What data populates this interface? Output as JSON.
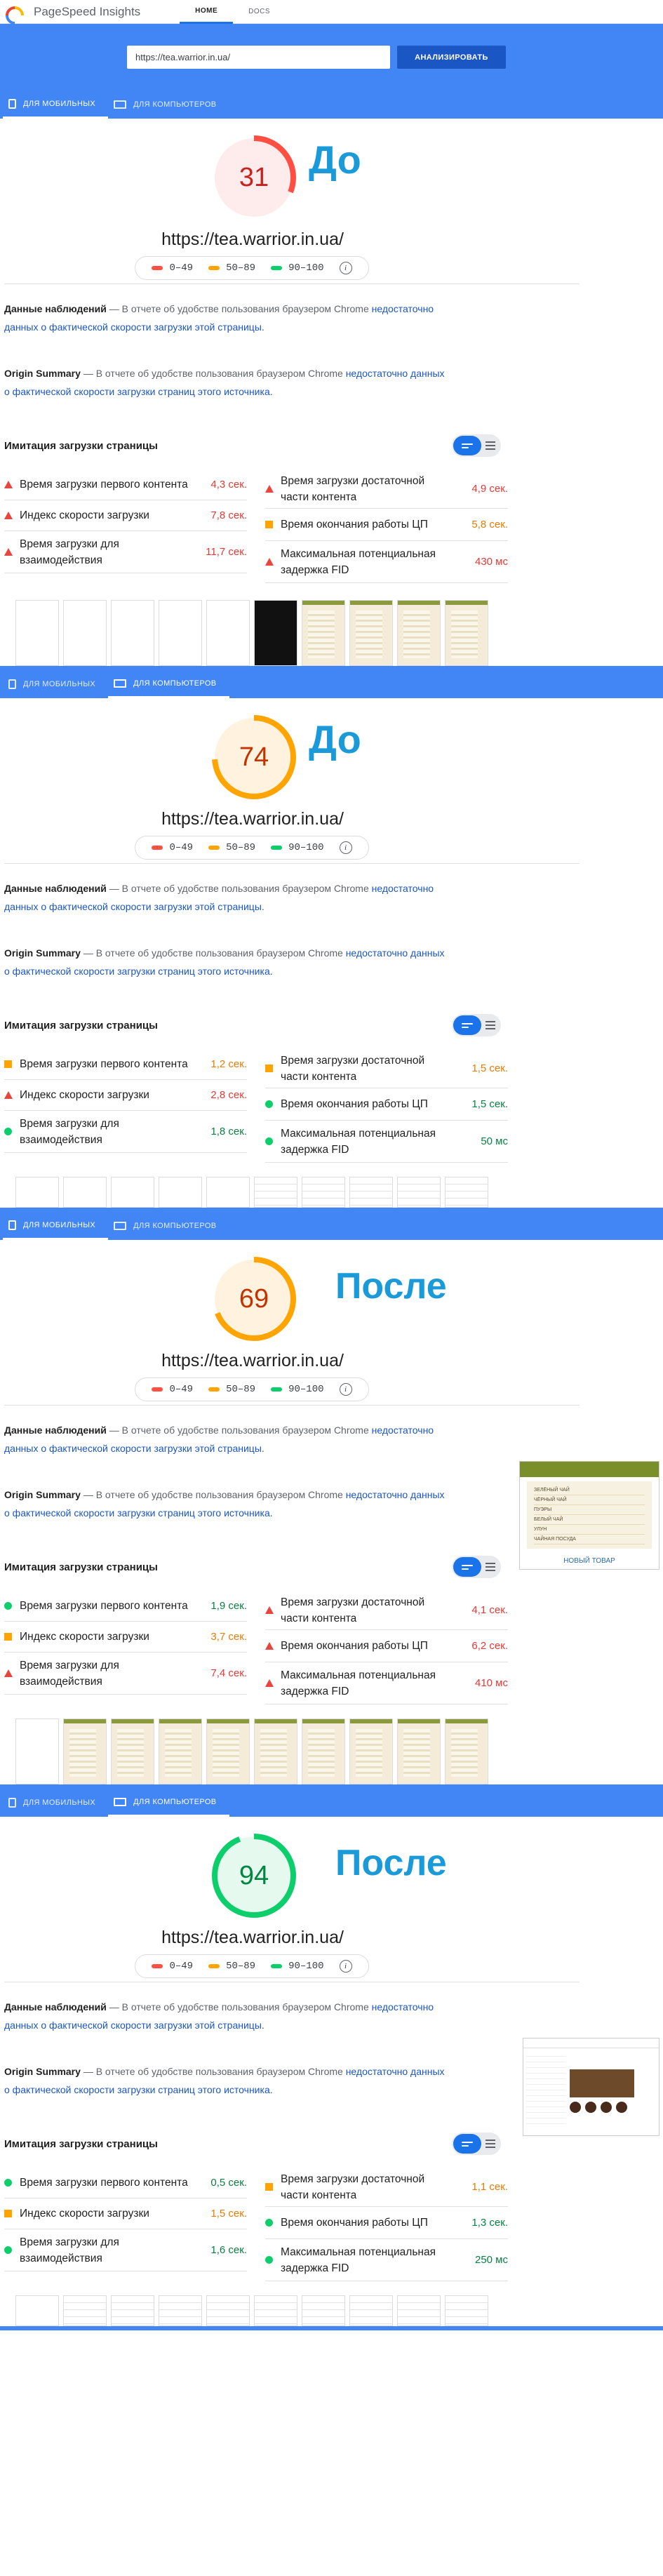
{
  "app": {
    "title": "PageSpeed Insights",
    "tabs": [
      "HOME",
      "DOCS"
    ],
    "active_tab": "HOME"
  },
  "search": {
    "url_value": "https://tea.warrior.in.ua/",
    "button": "АНАЛИЗИРОВАТЬ"
  },
  "device_tabs": {
    "mobile": "ДЛЯ МОБИЛЬНЫХ",
    "desktop": "ДЛЯ КОМПЬЮТЕРОВ"
  },
  "legend": {
    "ranges": [
      "0–49",
      "50–89",
      "90–100"
    ],
    "colors": [
      "#ff4e42",
      "#ffa400",
      "#0cce6b"
    ],
    "info": "i"
  },
  "texts": {
    "field_title": "Данные наблюдений",
    "field_line1": "— В отчете об удобстве пользования браузером Chrome",
    "field_link1": "недостаточно",
    "field_link2": "данных о фактической скорости загрузки этой страницы.",
    "origin_title": "Origin Summary",
    "origin_line1": "— В отчете об удобстве пользования браузером Chrome",
    "origin_link1": "недостаточно данных",
    "origin_link2": "о фактической скорости загрузки страниц этого источника.",
    "lab_title": "Имитация загрузки страницы"
  },
  "metric_labels": {
    "fcp": "Время загрузки первого контента",
    "si": "Индекс скорости загрузки",
    "tti1": "Время загрузки для",
    "tti2": "взаимодействия",
    "fmp1": "Время загрузки достаточной",
    "fmp2": "части контента",
    "cpu": "Время окончания работы ЦП",
    "fid1": "Максимальная потенциальная",
    "fid2": "задержка FID"
  },
  "reports": [
    {
      "device": "mobile",
      "score": 31,
      "status": "red",
      "label": "До",
      "url": "https://tea.warrior.in.ua/",
      "metrics": {
        "fcp": {
          "v": "4,3 сек.",
          "s": "red"
        },
        "si": {
          "v": "7,8 сек.",
          "s": "red"
        },
        "tti": {
          "v": "11,7 сек.",
          "s": "red"
        },
        "fmp": {
          "v": "4,9 сек.",
          "s": "red"
        },
        "cpu": {
          "v": "5,8 сек.",
          "s": "orange"
        },
        "fid": {
          "v": "430 мс",
          "s": "red"
        }
      }
    },
    {
      "device": "desktop",
      "score": 74,
      "status": "orange",
      "label": "До",
      "url": "https://tea.warrior.in.ua/",
      "metrics": {
        "fcp": {
          "v": "1,2 сек.",
          "s": "orange"
        },
        "si": {
          "v": "2,8 сек.",
          "s": "red"
        },
        "tti": {
          "v": "1,8 сек.",
          "s": "green"
        },
        "fmp": {
          "v": "1,5 сек.",
          "s": "orange"
        },
        "cpu": {
          "v": "1,5 сек.",
          "s": "green"
        },
        "fid": {
          "v": "50 мс",
          "s": "green"
        }
      }
    },
    {
      "device": "mobile",
      "score": 69,
      "status": "orange",
      "label": "После",
      "url": "https://tea.warrior.in.ua/",
      "metrics": {
        "fcp": {
          "v": "1,9 сек.",
          "s": "green"
        },
        "si": {
          "v": "3,7 сек.",
          "s": "orange"
        },
        "tti": {
          "v": "7,4 сек.",
          "s": "red"
        },
        "fmp": {
          "v": "4,1 сек.",
          "s": "red"
        },
        "cpu": {
          "v": "6,2 сек.",
          "s": "red"
        },
        "fid": {
          "v": "410 мс",
          "s": "red"
        }
      },
      "preview_mobile": {
        "items": [
          "ЗЕЛЁНЫЙ ЧАЙ",
          "ЧЁРНЫЙ ЧАЙ",
          "ПУЭРЫ",
          "БЕЛЫЙ ЧАЙ",
          "УЛУН",
          "ЧАЙНАЯ ПОСУДА"
        ],
        "footer": "НОВЫЙ ТОВАР"
      }
    },
    {
      "device": "desktop",
      "score": 94,
      "status": "green",
      "label": "После",
      "url": "https://tea.warrior.in.ua/",
      "metrics": {
        "fcp": {
          "v": "0,5 сек.",
          "s": "green"
        },
        "si": {
          "v": "1,5 сек.",
          "s": "orange"
        },
        "tti": {
          "v": "1,6 сек.",
          "s": "green"
        },
        "fmp": {
          "v": "1,1 сек.",
          "s": "orange"
        },
        "cpu": {
          "v": "1,3 сек.",
          "s": "green"
        },
        "fid": {
          "v": "250 мс",
          "s": "green"
        }
      }
    }
  ],
  "score_colors": {
    "red": "#ff4e42",
    "orange": "#ffa400",
    "green": "#0cce6b"
  },
  "score_text_colors": {
    "red": "#c7221f",
    "orange": "#c33300",
    "green": "#018642"
  },
  "score_bg": {
    "red": "#fdeceb",
    "orange": "#fff3e0",
    "green": "#e6f9ef"
  }
}
